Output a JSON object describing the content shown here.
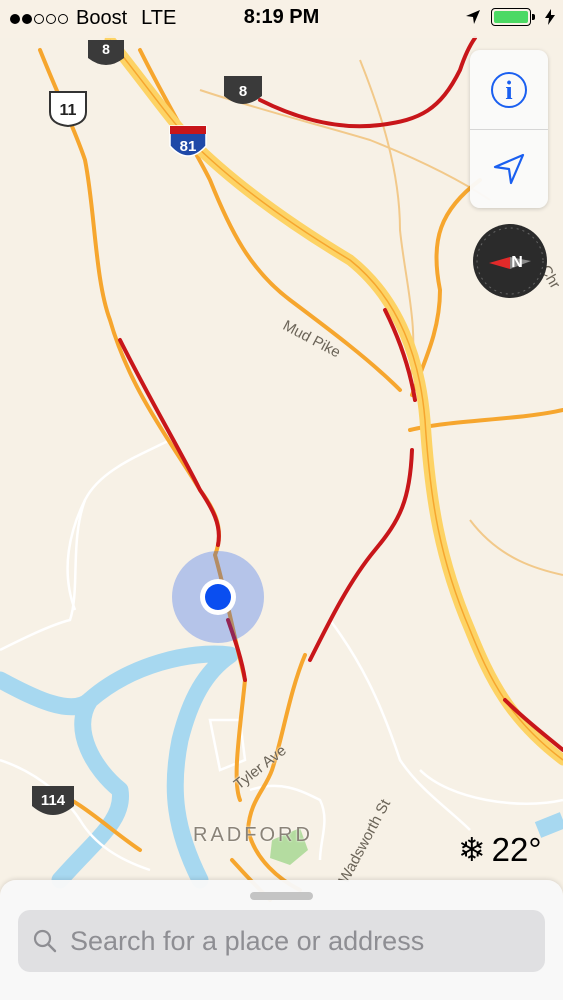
{
  "status_bar": {
    "carrier": "Boost",
    "network": "LTE",
    "time": "8:19 PM"
  },
  "map": {
    "route_shields": [
      {
        "id": "sr8_a",
        "label": "8",
        "type": "state"
      },
      {
        "id": "sr8_b",
        "label": "8",
        "type": "state"
      },
      {
        "id": "us11",
        "label": "11",
        "type": "us"
      },
      {
        "id": "i81",
        "label": "81",
        "type": "interstate"
      },
      {
        "id": "sr114",
        "label": "114",
        "type": "state"
      }
    ],
    "road_labels": {
      "mud_pike": "Mud Pike",
      "tyler_ave": "Tyler Ave",
      "wadsworth_st": "Wadsworth St",
      "partial": "Chr"
    },
    "city_label": "RADFORD",
    "colors": {
      "background": "#f7f1e6",
      "highway": "#fdd365",
      "arterial": "#f6a62e",
      "traffic_heavy": "#c8161a",
      "water": "#a7d8f0",
      "park": "#b4dca0",
      "user_location": "#0a4ef0"
    }
  },
  "controls": {
    "info_icon": "info-icon",
    "location_icon": "location-arrow-icon",
    "compass_icon": "compass-icon",
    "compass_letter": "N"
  },
  "weather": {
    "icon": "snowflake-icon",
    "symbol": "❄",
    "temperature": "22°"
  },
  "search": {
    "placeholder": "Search for a place or address"
  }
}
